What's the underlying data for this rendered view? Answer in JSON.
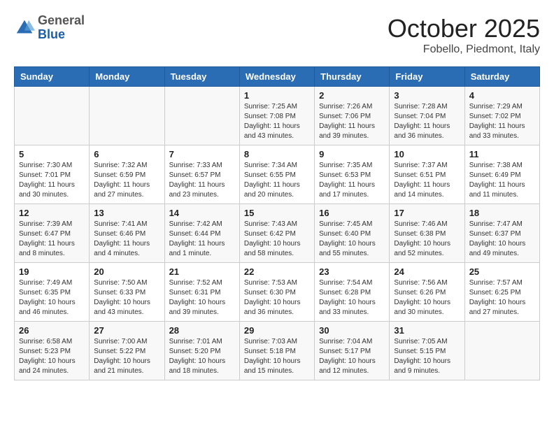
{
  "header": {
    "logo": {
      "general": "General",
      "blue": "Blue"
    },
    "title": "October 2025",
    "location": "Fobello, Piedmont, Italy"
  },
  "calendar": {
    "days_of_week": [
      "Sunday",
      "Monday",
      "Tuesday",
      "Wednesday",
      "Thursday",
      "Friday",
      "Saturday"
    ],
    "weeks": [
      [
        {
          "day": "",
          "info": ""
        },
        {
          "day": "",
          "info": ""
        },
        {
          "day": "",
          "info": ""
        },
        {
          "day": "1",
          "info": "Sunrise: 7:25 AM\nSunset: 7:08 PM\nDaylight: 11 hours and 43 minutes."
        },
        {
          "day": "2",
          "info": "Sunrise: 7:26 AM\nSunset: 7:06 PM\nDaylight: 11 hours and 39 minutes."
        },
        {
          "day": "3",
          "info": "Sunrise: 7:28 AM\nSunset: 7:04 PM\nDaylight: 11 hours and 36 minutes."
        },
        {
          "day": "4",
          "info": "Sunrise: 7:29 AM\nSunset: 7:02 PM\nDaylight: 11 hours and 33 minutes."
        }
      ],
      [
        {
          "day": "5",
          "info": "Sunrise: 7:30 AM\nSunset: 7:01 PM\nDaylight: 11 hours and 30 minutes."
        },
        {
          "day": "6",
          "info": "Sunrise: 7:32 AM\nSunset: 6:59 PM\nDaylight: 11 hours and 27 minutes."
        },
        {
          "day": "7",
          "info": "Sunrise: 7:33 AM\nSunset: 6:57 PM\nDaylight: 11 hours and 23 minutes."
        },
        {
          "day": "8",
          "info": "Sunrise: 7:34 AM\nSunset: 6:55 PM\nDaylight: 11 hours and 20 minutes."
        },
        {
          "day": "9",
          "info": "Sunrise: 7:35 AM\nSunset: 6:53 PM\nDaylight: 11 hours and 17 minutes."
        },
        {
          "day": "10",
          "info": "Sunrise: 7:37 AM\nSunset: 6:51 PM\nDaylight: 11 hours and 14 minutes."
        },
        {
          "day": "11",
          "info": "Sunrise: 7:38 AM\nSunset: 6:49 PM\nDaylight: 11 hours and 11 minutes."
        }
      ],
      [
        {
          "day": "12",
          "info": "Sunrise: 7:39 AM\nSunset: 6:47 PM\nDaylight: 11 hours and 8 minutes."
        },
        {
          "day": "13",
          "info": "Sunrise: 7:41 AM\nSunset: 6:46 PM\nDaylight: 11 hours and 4 minutes."
        },
        {
          "day": "14",
          "info": "Sunrise: 7:42 AM\nSunset: 6:44 PM\nDaylight: 11 hours and 1 minute."
        },
        {
          "day": "15",
          "info": "Sunrise: 7:43 AM\nSunset: 6:42 PM\nDaylight: 10 hours and 58 minutes."
        },
        {
          "day": "16",
          "info": "Sunrise: 7:45 AM\nSunset: 6:40 PM\nDaylight: 10 hours and 55 minutes."
        },
        {
          "day": "17",
          "info": "Sunrise: 7:46 AM\nSunset: 6:38 PM\nDaylight: 10 hours and 52 minutes."
        },
        {
          "day": "18",
          "info": "Sunrise: 7:47 AM\nSunset: 6:37 PM\nDaylight: 10 hours and 49 minutes."
        }
      ],
      [
        {
          "day": "19",
          "info": "Sunrise: 7:49 AM\nSunset: 6:35 PM\nDaylight: 10 hours and 46 minutes."
        },
        {
          "day": "20",
          "info": "Sunrise: 7:50 AM\nSunset: 6:33 PM\nDaylight: 10 hours and 43 minutes."
        },
        {
          "day": "21",
          "info": "Sunrise: 7:52 AM\nSunset: 6:31 PM\nDaylight: 10 hours and 39 minutes."
        },
        {
          "day": "22",
          "info": "Sunrise: 7:53 AM\nSunset: 6:30 PM\nDaylight: 10 hours and 36 minutes."
        },
        {
          "day": "23",
          "info": "Sunrise: 7:54 AM\nSunset: 6:28 PM\nDaylight: 10 hours and 33 minutes."
        },
        {
          "day": "24",
          "info": "Sunrise: 7:56 AM\nSunset: 6:26 PM\nDaylight: 10 hours and 30 minutes."
        },
        {
          "day": "25",
          "info": "Sunrise: 7:57 AM\nSunset: 6:25 PM\nDaylight: 10 hours and 27 minutes."
        }
      ],
      [
        {
          "day": "26",
          "info": "Sunrise: 6:58 AM\nSunset: 5:23 PM\nDaylight: 10 hours and 24 minutes."
        },
        {
          "day": "27",
          "info": "Sunrise: 7:00 AM\nSunset: 5:22 PM\nDaylight: 10 hours and 21 minutes."
        },
        {
          "day": "28",
          "info": "Sunrise: 7:01 AM\nSunset: 5:20 PM\nDaylight: 10 hours and 18 minutes."
        },
        {
          "day": "29",
          "info": "Sunrise: 7:03 AM\nSunset: 5:18 PM\nDaylight: 10 hours and 15 minutes."
        },
        {
          "day": "30",
          "info": "Sunrise: 7:04 AM\nSunset: 5:17 PM\nDaylight: 10 hours and 12 minutes."
        },
        {
          "day": "31",
          "info": "Sunrise: 7:05 AM\nSunset: 5:15 PM\nDaylight: 10 hours and 9 minutes."
        },
        {
          "day": "",
          "info": ""
        }
      ]
    ]
  }
}
